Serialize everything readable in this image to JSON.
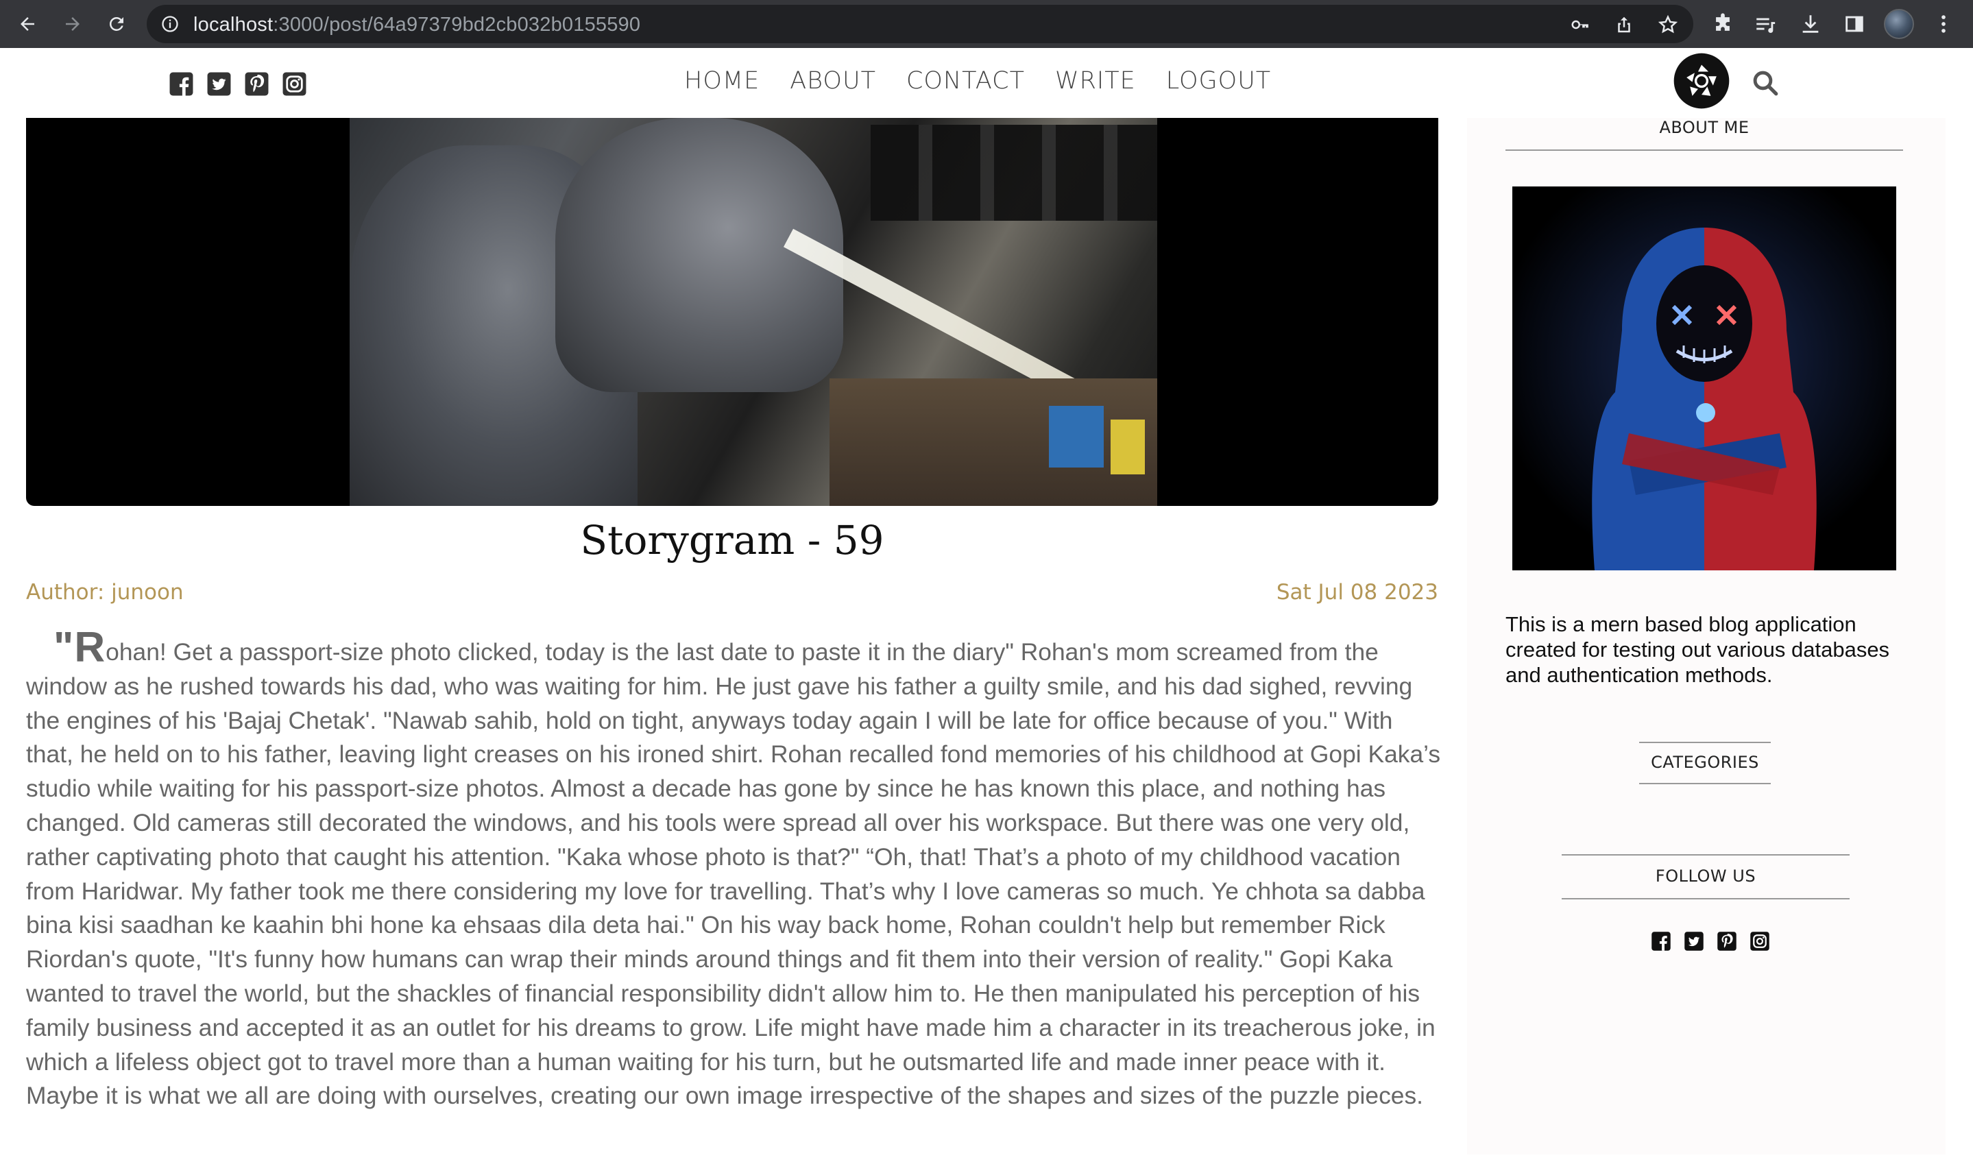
{
  "browser": {
    "url_host": "localhost",
    "url_path": ":3000/post/64a97379bd2cb032b0155590"
  },
  "site": {
    "menu": [
      "HOME",
      "ABOUT",
      "CONTACT",
      "WRITE",
      "LOGOUT"
    ],
    "social_icons": [
      "facebook-square-icon",
      "twitter-square-icon",
      "pinterest-square-icon",
      "instagram-icon"
    ]
  },
  "post": {
    "title": "Storygram - 59",
    "author": "Author: junoon",
    "date": "Sat Jul 08 2023",
    "dropcap": "\"R",
    "body": "ohan! Get a passport-size photo clicked, today is the last date to paste it in the diary\" Rohan's mom screamed from the window as he rushed towards his dad, who was waiting for him. He just gave his father a guilty smile, and his dad sighed, revving the engines of his 'Bajaj Chetak'. \"Nawab sahib, hold on tight, anyways today again I will be late for office because of you.\" With that, he held on to his father, leaving light creases on his ironed shirt. Rohan recalled fond memories of his childhood at Gopi Kaka’s studio while waiting for his passport-size photos. Almost a decade has gone by since he has known this place, and nothing has changed. Old cameras still decorated the windows, and his tools were spread all over his workspace. But there was one very old, rather captivating photo that caught his attention. \"Kaka whose photo is that?\" “Oh, that! That’s a photo of my childhood vacation from Haridwar. My father took me there considering my love for travelling. That’s why I love cameras so much. Ye chhota sa dabba bina kisi saadhan ke kaahin bhi hone ka ehsaas dila deta hai.\" On his way back home, Rohan couldn't help but remember Rick Riordan's quote, \"It's funny how humans can wrap their minds around things and fit them into their version of reality.\" Gopi Kaka wanted to travel the world, but the shackles of financial responsibility didn't allow him to. He then manipulated his perception of his family business and accepted it as an outlet for his dreams to grow. Life might have made him a character in its treacherous joke, in which a lifeless object got to travel more than a human waiting for his turn, but he outsmarted life and made inner peace with it. Maybe it is what we all are doing with ourselves, creating our own image irrespective of the shapes and sizes of the puzzle pieces."
  },
  "sidebar": {
    "about_title": "ABOUT ME",
    "description": "This is a mern based blog application created for testing out various databases and authentication methods.",
    "categories_title": "CATEGORIES",
    "follow_title": "FOLLOW US"
  },
  "colors": {
    "accent_gold": "#b39656",
    "body_text": "#666666",
    "chrome_bg": "#35363a"
  }
}
